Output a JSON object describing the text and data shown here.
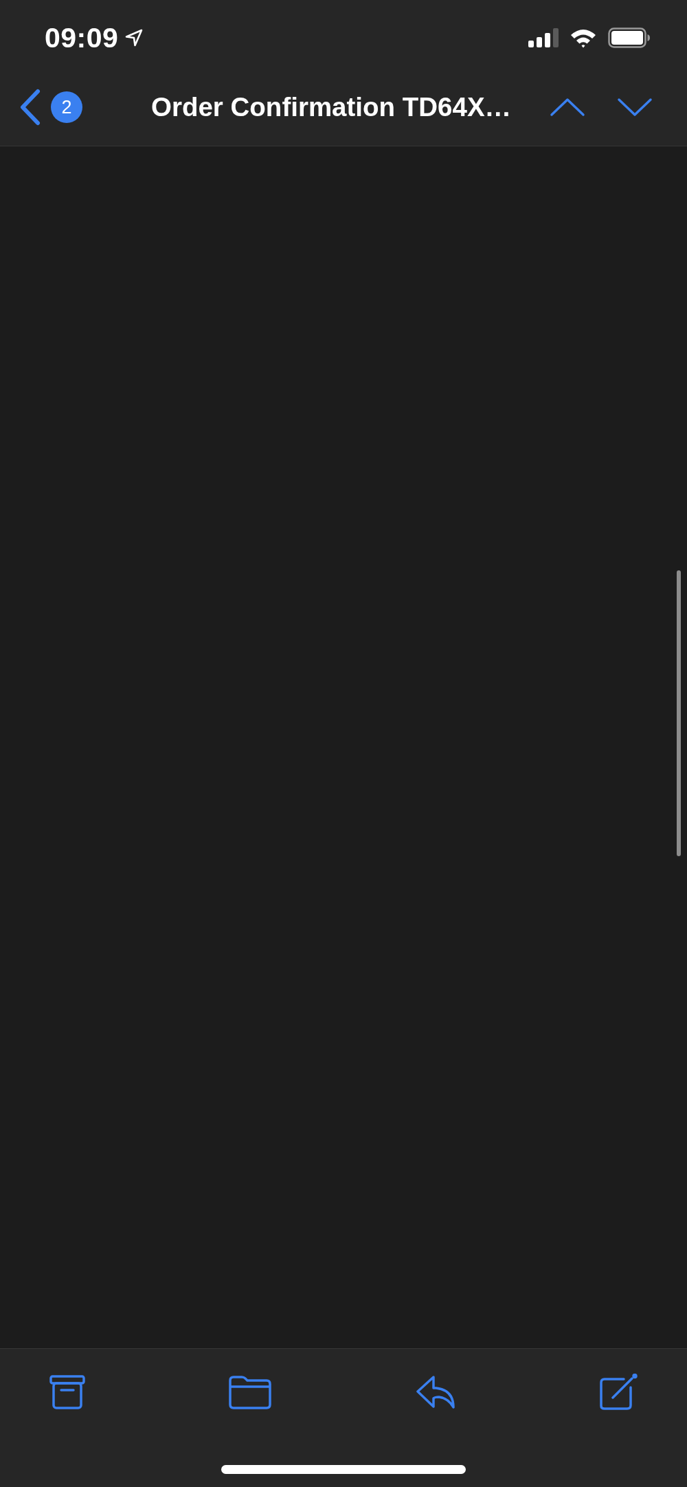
{
  "status_bar": {
    "time": "09:09"
  },
  "nav_bar": {
    "badge": "2",
    "title": "Order Confirmation TD64X…"
  },
  "toolbar": {
    "buttons": [
      {
        "kind": "archive"
      },
      {
        "kind": "move"
      },
      {
        "kind": "reply"
      },
      {
        "kind": "compose"
      }
    ]
  }
}
